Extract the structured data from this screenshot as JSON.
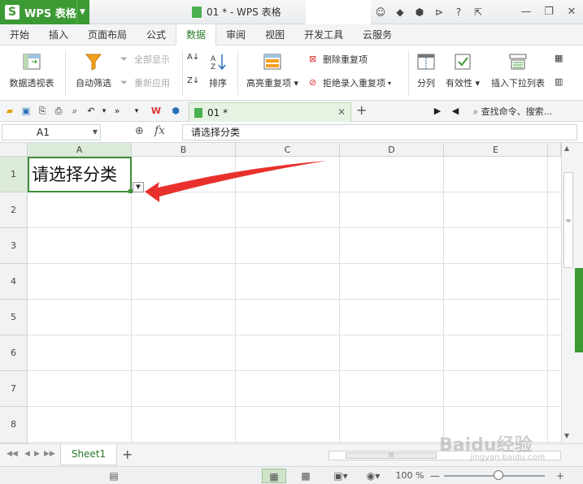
{
  "app": {
    "name": "WPS 表格",
    "doc_title": "01 * - WPS 表格"
  },
  "tabs": [
    "开始",
    "插入",
    "页面布局",
    "公式",
    "数据",
    "审阅",
    "视图",
    "开发工具",
    "云服务"
  ],
  "active_tab": "数据",
  "ribbon": {
    "pivot": "数据透视表",
    "autofilter": "自动筛选",
    "show_all": "全部显示",
    "reapply": "重新应用",
    "sort": "排序",
    "highlight_dup": "高亮重复项",
    "remove_dup": "删除重复项",
    "reject_dup": "拒绝录入重复项",
    "split": "分列",
    "validity": "有效性",
    "insert_dropdown": "插入下拉列表"
  },
  "doc_tab": {
    "label": "01 *"
  },
  "search_cmd": "查找命令、搜索...",
  "formula_bar": {
    "cell_ref": "A1",
    "fx": "fx",
    "value": "请选择分类"
  },
  "grid": {
    "columns": [
      "A",
      "B",
      "C",
      "D",
      "E"
    ],
    "rows": [
      "1",
      "2",
      "3",
      "4",
      "5",
      "6",
      "7",
      "8"
    ],
    "selected_cell": "A1",
    "a1_value": "请选择分类"
  },
  "sheets": [
    "Sheet1"
  ],
  "status": {
    "zoom": "100 %"
  },
  "watermark": {
    "main": "Baidu经验",
    "sub": "jingyan.baidu.com"
  },
  "colors": {
    "accent": "#3c9a35",
    "arrow": "#e8302c",
    "selection": "#dcebd8"
  }
}
